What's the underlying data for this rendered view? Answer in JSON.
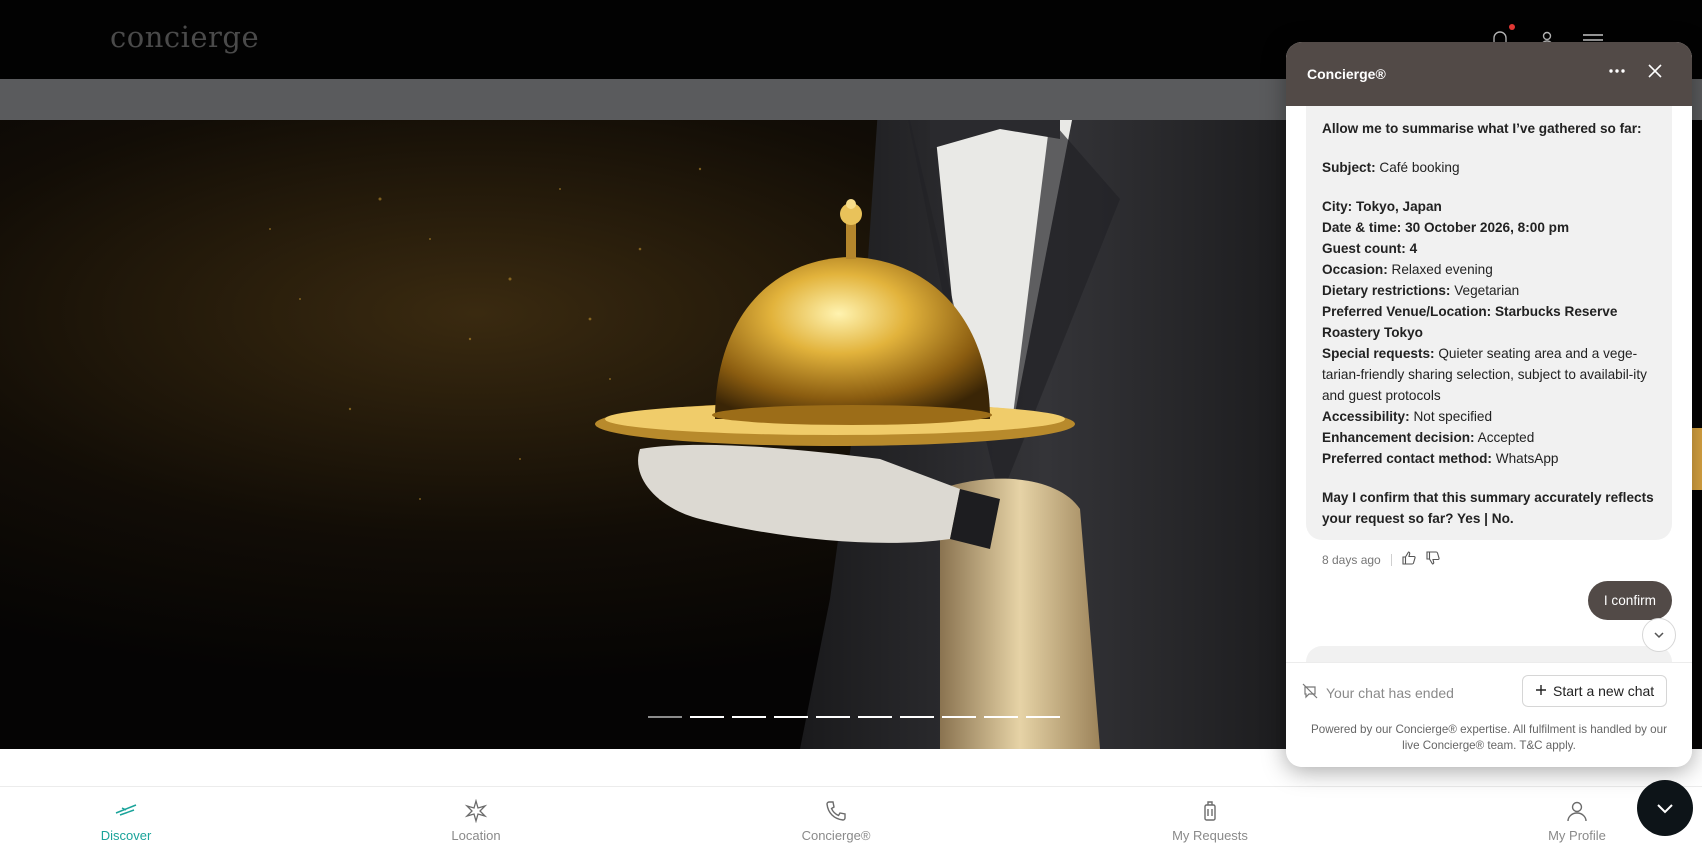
{
  "header": {
    "logo": "concierge",
    "icons": [
      "bell-icon",
      "user-icon",
      "menu-icon"
    ],
    "notification_dot_color": "#e53935"
  },
  "hero": {
    "slide_count": 10,
    "active_slide": 1,
    "accent": "#d9a441"
  },
  "chat": {
    "title": "Concierge®",
    "intro": "Allow me to summarise what I’ve gathered so far:",
    "subject_label": "Subject:",
    "subject_value": "Café booking",
    "details": [
      {
        "label": "City: Tokyo, Japan",
        "value": ""
      },
      {
        "label": "Date & time: 30 October 2026, 8:00 pm",
        "value": ""
      },
      {
        "label": "Guest count: 4",
        "value": ""
      },
      {
        "label": "Occasion:",
        "value": "Relaxed evening"
      },
      {
        "label": "Dietary restrictions:",
        "value": "Vegetarian"
      },
      {
        "label": "Preferred Venue/Location: Starbucks Reserve Roastery Tokyo",
        "value": ""
      },
      {
        "label": "Special requests:",
        "value": "Quieter seating area and a vege-tarian-friendly sharing selection, subject to availabil-ity and guest protocols"
      },
      {
        "label": "Accessibility:",
        "value": "Not specified"
      },
      {
        "label": "Enhancement decision:",
        "value": "Accepted"
      },
      {
        "label": "Preferred contact method:",
        "value": "WhatsApp"
      }
    ],
    "question": "May I confirm that this summary accurately reflects your request so far? Yes | No.",
    "timestamp": "8 days ago",
    "user_message": "I confirm",
    "ended_text": "Your chat has ended",
    "new_chat_label": "Start a new chat",
    "powered_by": "Powered by our Concierge® expertise. All fulfilment is handled by our live Concierge® team. T&C apply."
  },
  "bottom_nav": {
    "items": [
      {
        "label": "Discover",
        "icon": "plane-icon",
        "active": true
      },
      {
        "label": "Location",
        "icon": "compass-star-icon",
        "active": false
      },
      {
        "label": "Concierge®",
        "icon": "phone-icon",
        "active": false
      },
      {
        "label": "My Requests",
        "icon": "luggage-icon",
        "active": false
      },
      {
        "label": "My Profile",
        "icon": "profile-icon",
        "active": false
      }
    ],
    "active_color": "#1aa39a"
  }
}
